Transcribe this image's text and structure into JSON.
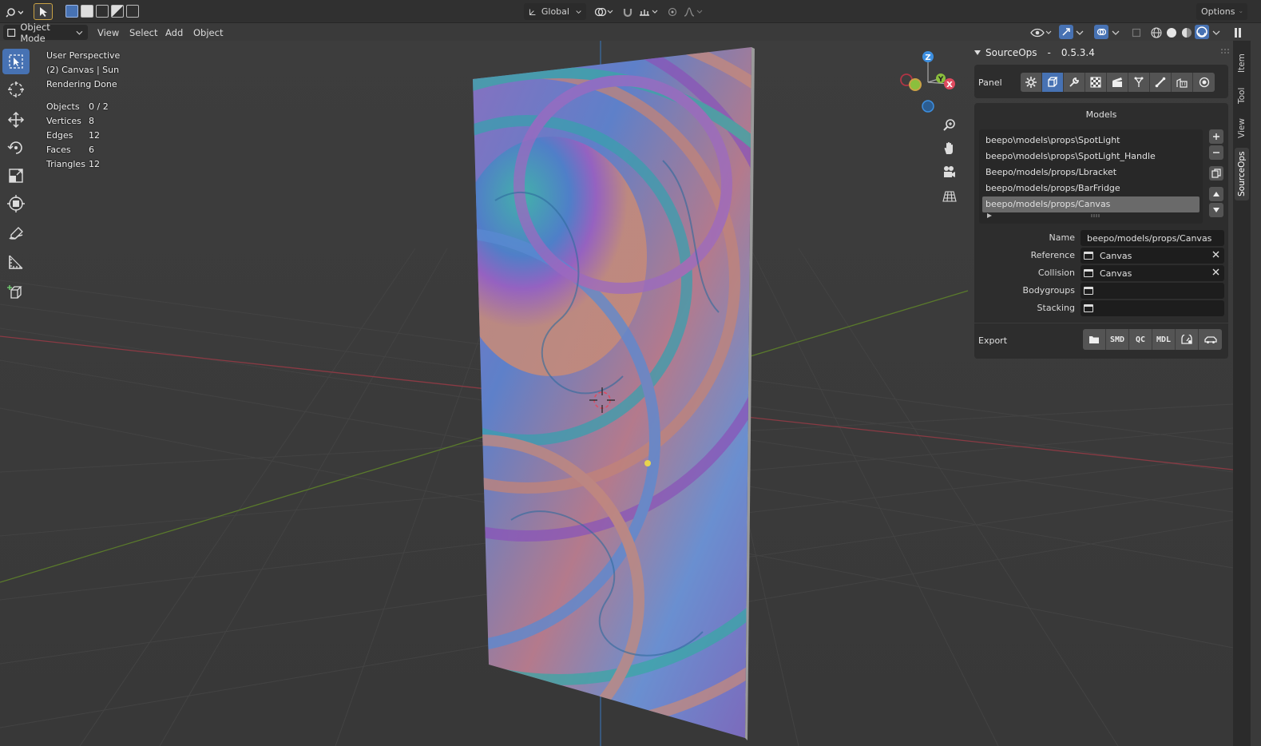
{
  "topbar": {
    "orientation_label": "Global",
    "options_label": "Options"
  },
  "viewport_header": {
    "mode_label": "Object Mode",
    "menu": [
      "View",
      "Select",
      "Add",
      "Object"
    ]
  },
  "overlay": {
    "line1": "User Perspective",
    "line2": "(2) Canvas | Sun",
    "line3": "Rendering Done",
    "stats": [
      {
        "label": "Objects",
        "value": "0 / 2"
      },
      {
        "label": "Vertices",
        "value": "8"
      },
      {
        "label": "Edges",
        "value": "12"
      },
      {
        "label": "Faces",
        "value": "6"
      },
      {
        "label": "Triangles",
        "value": "12"
      }
    ]
  },
  "gizmo": {
    "axis_z": "Z",
    "axis_y": "Y",
    "axis_x": "X"
  },
  "npanel": {
    "addon_title": "SourceOps",
    "separator": "-",
    "version": "0.5.3.4",
    "panel_label": "Panel",
    "models_header": "Models",
    "models": [
      "beepo\\models\\props\\SpotLight",
      "beepo\\models\\props\\SpotLight_Handle",
      "Beepo/models/props/Lbracket",
      "beepo/models/props/BarFridge",
      "beepo/models/props/Canvas"
    ],
    "selected_model_index": 4,
    "fields": {
      "name_label": "Name",
      "name_value": "beepo/models/props/Canvas",
      "reference_label": "Reference",
      "reference_value": "Canvas",
      "collision_label": "Collision",
      "collision_value": "Canvas",
      "bodygroups_label": "Bodygroups",
      "stacking_label": "Stacking"
    },
    "export_label": "Export",
    "export_buttons": [
      "SMD",
      "QC",
      "MDL"
    ]
  },
  "tabs": [
    "Item",
    "Tool",
    "View",
    "SourceOps"
  ],
  "active_tab": "SourceOps",
  "colors": {
    "accent": "#4772b3",
    "x_axis": "#e04a5f",
    "y_axis": "#8bbf3d",
    "z_axis": "#3d8fe0",
    "light_dot": "#e8d44d"
  }
}
